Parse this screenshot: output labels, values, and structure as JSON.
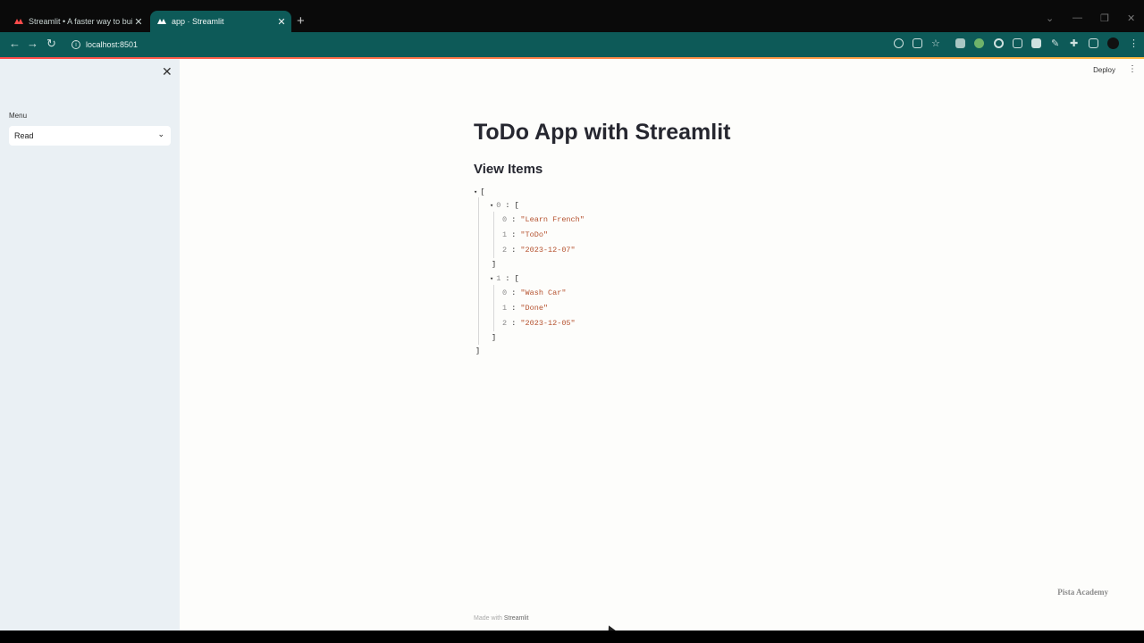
{
  "browser": {
    "tabs": [
      {
        "title": "Streamlit • A faster way to build",
        "active": false
      },
      {
        "title": "app · Streamlit",
        "active": true
      }
    ],
    "new_tab": "+",
    "url": "localhost:8501"
  },
  "sidebar": {
    "menu_label": "Menu",
    "menu_selected": "Read"
  },
  "header": {
    "deploy_label": "Deploy"
  },
  "main": {
    "title": "ToDo App with Streamlit",
    "subtitle": "View Items",
    "json_rows": [
      {
        "indent": 0,
        "caret": true,
        "key": "",
        "text": "["
      },
      {
        "indent": 1,
        "caret": true,
        "key": "0",
        "text": "["
      },
      {
        "indent": 2,
        "caret": false,
        "key": "0",
        "value": "\"Learn French\""
      },
      {
        "indent": 2,
        "caret": false,
        "key": "1",
        "value": "\"ToDo\""
      },
      {
        "indent": 2,
        "caret": false,
        "key": "2",
        "value": "\"2023-12-07\""
      },
      {
        "indent": 1,
        "caret": false,
        "key": "",
        "text": "]"
      },
      {
        "indent": 1,
        "caret": true,
        "key": "1",
        "text": "["
      },
      {
        "indent": 2,
        "caret": false,
        "key": "0",
        "value": "\"Wash Car\""
      },
      {
        "indent": 2,
        "caret": false,
        "key": "1",
        "value": "\"Done\""
      },
      {
        "indent": 2,
        "caret": false,
        "key": "2",
        "value": "\"2023-12-05\""
      },
      {
        "indent": 1,
        "caret": false,
        "key": "",
        "text": "]"
      },
      {
        "indent": 0,
        "caret": false,
        "key": "",
        "text": "]"
      }
    ]
  },
  "footer": {
    "made_with": "Made with",
    "brand": "Streamlit"
  },
  "watermark": "Pista Academy",
  "colors": {
    "toolbar": "#0d5a58",
    "sidebar": "#eaf0f4",
    "string_value": "#b5522f"
  }
}
